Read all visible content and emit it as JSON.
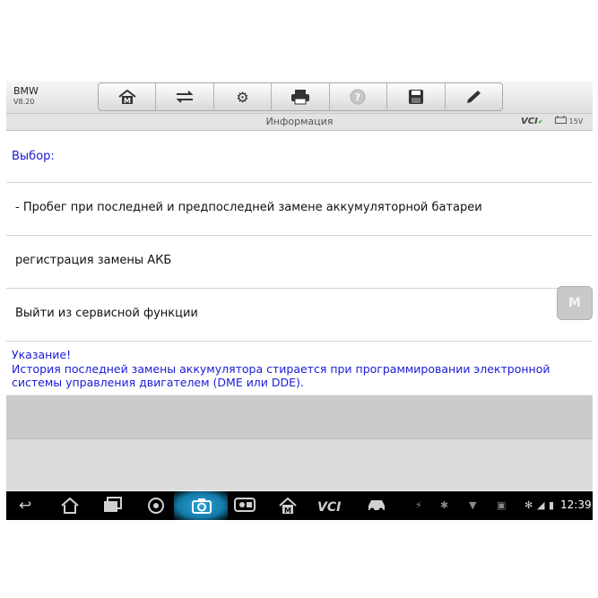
{
  "app": {
    "name": "BMW",
    "version": "V8.20"
  },
  "toolbar": {
    "home": "⌂",
    "vehicle": "⇄",
    "settings": "⚙",
    "print": "▤",
    "help": "?",
    "save": "▣",
    "edit": "╱"
  },
  "titlebar": {
    "title": "Информация",
    "vci": "VCI",
    "battery": "15V"
  },
  "content": {
    "selection_label": "Выбор:",
    "items": [
      "- Пробег при последней и предпоследней замене аккумуляторной батареи",
      "регистрация замены АКБ",
      "Выйти из сервисной функции"
    ],
    "hint": "Указание!\nИстория последней замены аккумулятора стирается при программировании электронной системы управления двигателем (DME или DDE)."
  },
  "float_button": "M",
  "navbar": {
    "back": "↩",
    "home": "⌂",
    "recent": "▭",
    "vci": "VCI",
    "time": "12:39"
  }
}
